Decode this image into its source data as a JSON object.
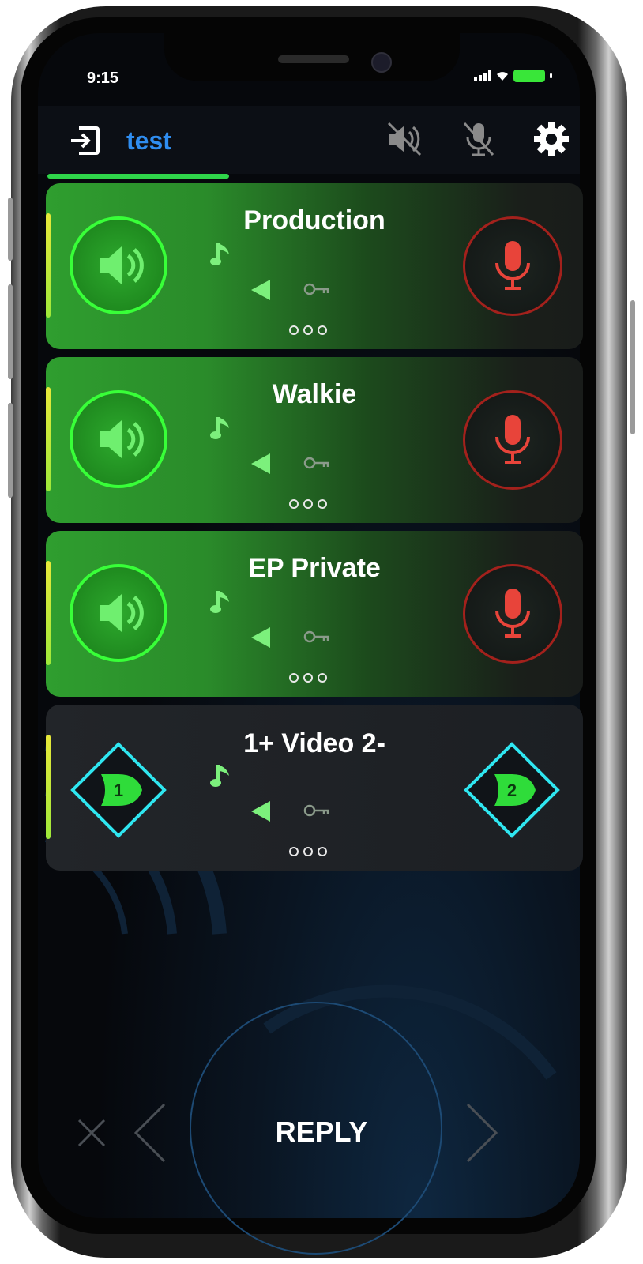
{
  "status_bar": {
    "time": "9:15"
  },
  "header": {
    "session_name": "test"
  },
  "channels": [
    {
      "name": "Production",
      "style": "green"
    },
    {
      "name": "Walkie",
      "style": "green"
    },
    {
      "name": "EP Private",
      "style": "green"
    },
    {
      "name": "1+ Video 2-",
      "style": "dark",
      "left_gate_label": "1",
      "right_gate_label": "2"
    }
  ],
  "bottom_nav": {
    "reply_label": "REPLY"
  },
  "colors": {
    "accent_green": "#38ff38",
    "mic_red": "#e8443a",
    "session_blue": "#2f8df0",
    "gate_cyan": "#2fe6f0"
  }
}
